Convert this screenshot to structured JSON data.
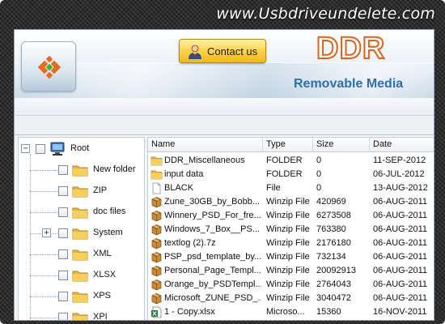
{
  "site_url": "www.Usbdriveundelete.com",
  "header": {
    "contact_label": "Contact us",
    "product_title": "DDR",
    "product_subtitle": "Removable Media"
  },
  "colors": {
    "title_orange": "#e0621a",
    "subtitle_blue": "#2c6fb5",
    "button_gold": "#fcd34a"
  },
  "tree": {
    "root_label": "Root",
    "items": [
      {
        "label": "New folder",
        "expandable": false
      },
      {
        "label": "ZIP",
        "expandable": false
      },
      {
        "label": "doc files",
        "expandable": false
      },
      {
        "label": "System",
        "expandable": true
      },
      {
        "label": "XML",
        "expandable": false
      },
      {
        "label": "XLSX",
        "expandable": false
      },
      {
        "label": "XPS",
        "expandable": false
      },
      {
        "label": "XPI",
        "expandable": false
      }
    ]
  },
  "file_list": {
    "columns": [
      "Name",
      "Type",
      "Size",
      "Date"
    ],
    "rows": [
      {
        "icon": "folder-icon",
        "name": "DDR_Miscellaneous",
        "type": "FOLDER",
        "size": "0",
        "date": "11-SEP-2012"
      },
      {
        "icon": "folder-icon",
        "name": "input data",
        "type": "FOLDER",
        "size": "0",
        "date": "06-JUL-2012"
      },
      {
        "icon": "blank-file-icon",
        "name": "BLACK",
        "type": "File",
        "size": "0",
        "date": "13-AUG-2012"
      },
      {
        "icon": "archive-icon",
        "name": "Zune_30GB_by_Bobb...",
        "type": "Winzip File",
        "size": "420969",
        "date": "06-AUG-2011"
      },
      {
        "icon": "archive-icon",
        "name": "Winnery_PSD_For_fre...",
        "type": "Winzip File",
        "size": "6273508",
        "date": "06-AUG-2011"
      },
      {
        "icon": "archive-icon",
        "name": "Windows_7_Box__PS...",
        "type": "Winzip File",
        "size": "763380",
        "date": "06-AUG-2011"
      },
      {
        "icon": "archive-icon",
        "name": "textlog (2).7z",
        "type": "Winzip File",
        "size": "2176180",
        "date": "06-AUG-2011"
      },
      {
        "icon": "archive-icon",
        "name": "PSP_psd_template_by...",
        "type": "Winzip File",
        "size": "732134",
        "date": "06-AUG-2011"
      },
      {
        "icon": "archive-icon",
        "name": "Personal_Page_Templ...",
        "type": "Winzip File",
        "size": "20092913",
        "date": "06-AUG-2011"
      },
      {
        "icon": "archive-icon",
        "name": "Orange_by_PSDTempl...",
        "type": "Winzip File",
        "size": "2764043",
        "date": "06-AUG-2011"
      },
      {
        "icon": "archive-icon",
        "name": "Microsoft_ZUNE_PSD_...",
        "type": "Winzip File",
        "size": "3040472",
        "date": "06-AUG-2011"
      },
      {
        "icon": "excel-file-icon",
        "name": "1 - Copy.xlsx",
        "type": "Microso...",
        "size": "15360",
        "date": "16-NOV-2011"
      }
    ]
  }
}
